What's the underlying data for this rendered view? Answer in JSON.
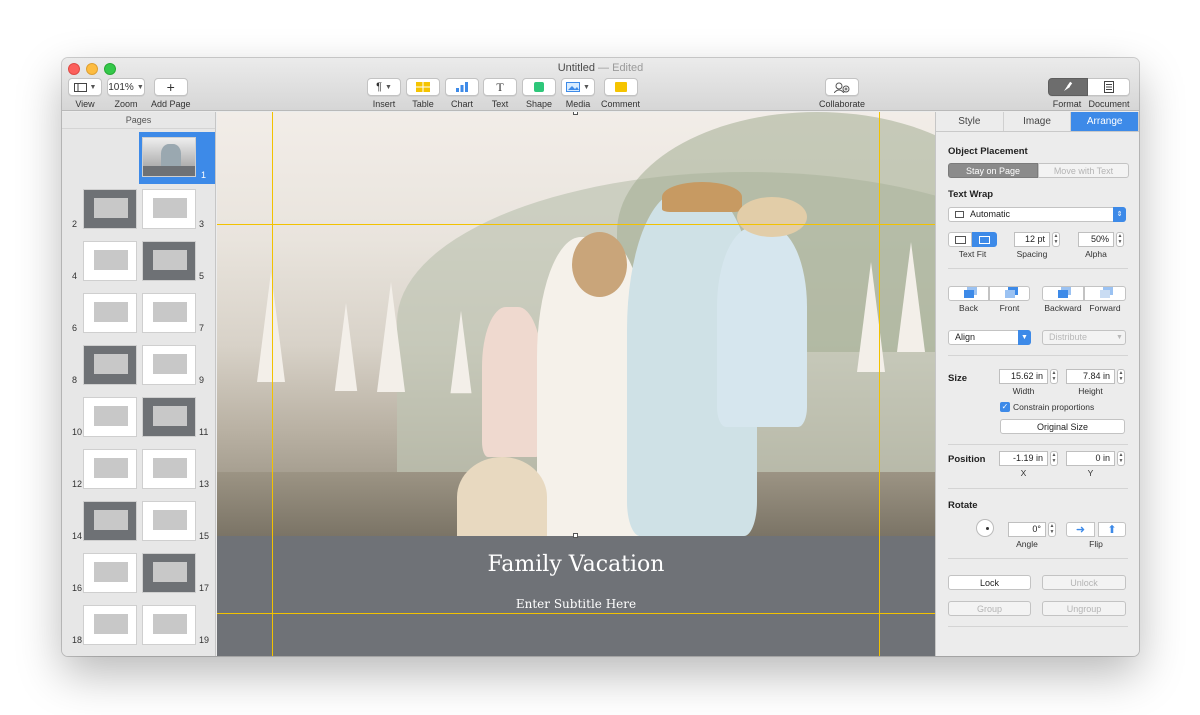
{
  "window": {
    "title": "Untitled",
    "edited": "— Edited"
  },
  "toolbar": {
    "left": [
      {
        "label": "View",
        "icon": "sidebar-icon"
      },
      {
        "label": "Zoom",
        "value": "101%"
      },
      {
        "label": "Add Page",
        "icon": "plus-icon"
      }
    ],
    "center": [
      {
        "label": "Insert",
        "icon": "paragraph-icon"
      },
      {
        "label": "Table",
        "icon": "table-icon"
      },
      {
        "label": "Chart",
        "icon": "chart-icon"
      },
      {
        "label": "Text",
        "icon": "text-icon"
      },
      {
        "label": "Shape",
        "icon": "shape-icon"
      },
      {
        "label": "Media",
        "icon": "media-icon"
      },
      {
        "label": "Comment",
        "icon": "comment-icon"
      }
    ],
    "collaborate": {
      "label": "Collaborate",
      "icon": "collaborate-icon"
    },
    "right": [
      {
        "label": "Format",
        "icon": "paintbrush-icon"
      },
      {
        "label": "Document",
        "icon": "document-icon"
      }
    ]
  },
  "pages": {
    "title": "Pages",
    "numbers": [
      "1",
      "2",
      "3",
      "4",
      "5",
      "6",
      "7",
      "8",
      "9",
      "10",
      "11",
      "12",
      "13",
      "14",
      "15",
      "16",
      "17",
      "18",
      "19"
    ],
    "selected": "1"
  },
  "canvas": {
    "title": "Family Vacation",
    "subtitle": "Enter Subtitle Here"
  },
  "inspector": {
    "tabs": [
      "Style",
      "Image",
      "Arrange"
    ],
    "active_tab": "Arrange",
    "object_placement": {
      "title": "Object Placement",
      "options": [
        "Stay on Page",
        "Move with Text"
      ]
    },
    "text_wrap": {
      "title": "Text Wrap",
      "value": "Automatic",
      "text_fit_label": "Text Fit",
      "spacing_value": "12 pt",
      "spacing_label": "Spacing",
      "alpha_value": "50%",
      "alpha_label": "Alpha"
    },
    "layering": {
      "back_label": "Back",
      "front_label": "Front",
      "backward_label": "Backward",
      "forward_label": "Forward"
    },
    "align": {
      "align_value": "Align",
      "distribute_value": "Distribute"
    },
    "size": {
      "title": "Size",
      "width_value": "15.62 in",
      "width_label": "Width",
      "height_value": "7.84 in",
      "height_label": "Height",
      "constrain_label": "Constrain proportions",
      "original_size_label": "Original Size"
    },
    "position": {
      "title": "Position",
      "x_value": "-1.19 in",
      "x_label": "X",
      "y_value": "0 in",
      "y_label": "Y"
    },
    "rotate": {
      "title": "Rotate",
      "angle_value": "0°",
      "angle_label": "Angle",
      "flip_label": "Flip"
    },
    "lock": {
      "lock_label": "Lock",
      "unlock_label": "Unlock",
      "group_label": "Group",
      "ungroup_label": "Ungroup"
    }
  },
  "colors": {
    "accent": "#3d8ae8",
    "guide": "#f2c200",
    "page_band": "#6f7277"
  }
}
